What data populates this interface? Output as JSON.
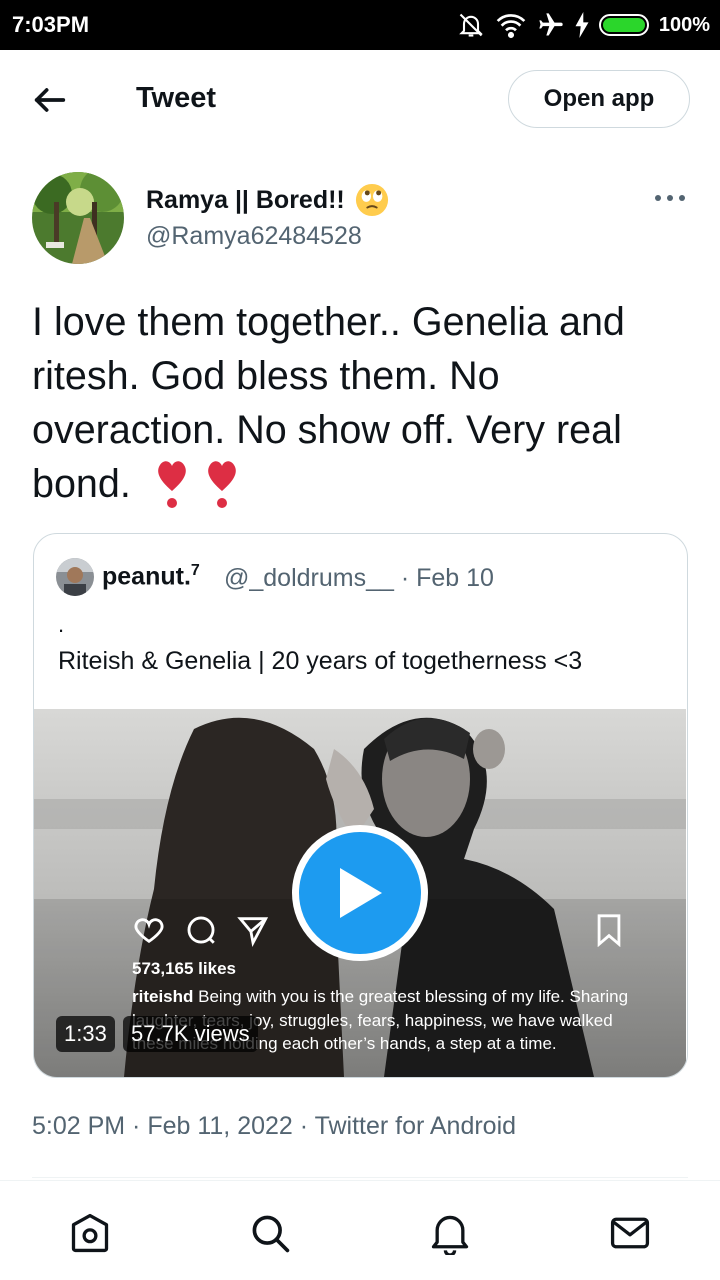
{
  "status_bar": {
    "time": "7:03PM",
    "battery_percent": "100%",
    "battery_level": 1.0,
    "icons": [
      "notifications-off-icon",
      "wifi-icon",
      "airplane-mode-icon",
      "charging-bolt-icon",
      "battery-icon"
    ]
  },
  "header": {
    "back_icon": "arrow-left-icon",
    "title": "Tweet",
    "open_app_label": "Open app"
  },
  "tweet": {
    "author_name": "Ramya || Bored!!",
    "author_emoji": "face-with-rolling-eyes",
    "author_handle": "@Ramya62484528",
    "more_icon": "more-horizontal-icon",
    "text": "I love them together.. Genelia and ritesh. God bless them. No overaction. No show off. Very real bond.",
    "text_emoji": [
      "heavy-heart-exclamation",
      "heavy-heart-exclamation"
    ],
    "timestamp": "5:02 PM · Feb 11, 2022 · Twitter for Android"
  },
  "quoted_tweet": {
    "name": "peanut.",
    "name_superscript": "7",
    "handle_date": "@_doldrums__ · Feb 10",
    "dot_line": ".",
    "text": "Riteish & Genelia | 20 years of togetherness <3",
    "video": {
      "duration": "1:33",
      "views": "57.7K views",
      "overlay_likes": "573,165 likes",
      "overlay_user": "riteishd",
      "overlay_caption": "Being with you is the greatest blessing of my life. Sharing laughter, tears, joy, struggles, fears, happiness, we have walked these miles holding each other’s hands, a step at a time."
    }
  },
  "bottom_nav": {
    "items": [
      "home-icon",
      "search-icon",
      "notifications-icon",
      "messages-icon"
    ]
  },
  "colors": {
    "accent": "#1d9bf0",
    "text_primary": "#0f1419",
    "text_secondary": "#536471",
    "border": "#cfd9de",
    "heart_red": "#dd2e44"
  }
}
